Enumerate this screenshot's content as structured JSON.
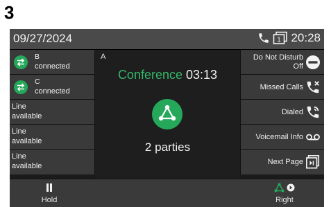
{
  "page_number": "3",
  "status_bar": {
    "date": "09/27/2024",
    "line_number": "1",
    "time": "20:28"
  },
  "line_keys": [
    {
      "name": "B",
      "status": "connected",
      "icon": "transfer-arrows-icon"
    },
    {
      "name": "C",
      "status": "connected",
      "icon": "transfer-arrows-icon"
    },
    {
      "line1": "Line",
      "line2": "available"
    },
    {
      "line1": "Line",
      "line2": "available"
    },
    {
      "line1": "Line",
      "line2": "available"
    }
  ],
  "call_panel": {
    "line_id": "A",
    "conference_label": "Conference",
    "conference_time": "03:13",
    "parties": "2 parties"
  },
  "right_keys": [
    {
      "line1": "Do Not Disturb",
      "line2": "Off",
      "icon": "do-not-disturb-icon"
    },
    {
      "label": "Missed Calls",
      "icon": "missed-calls-icon"
    },
    {
      "label": "Dialed",
      "icon": "dialed-calls-icon"
    },
    {
      "label": "Voicemail Info",
      "icon": "voicemail-icon"
    },
    {
      "label": "Next Page",
      "icon": "next-page-icon"
    }
  ],
  "softkeys": {
    "hold": "Hold",
    "right": "Right"
  },
  "colors": {
    "accent_green": "#26a85b",
    "conference_text": "#34b86a",
    "status_bar": "#4a4a4a",
    "key_bg": "#3a3a3a"
  }
}
